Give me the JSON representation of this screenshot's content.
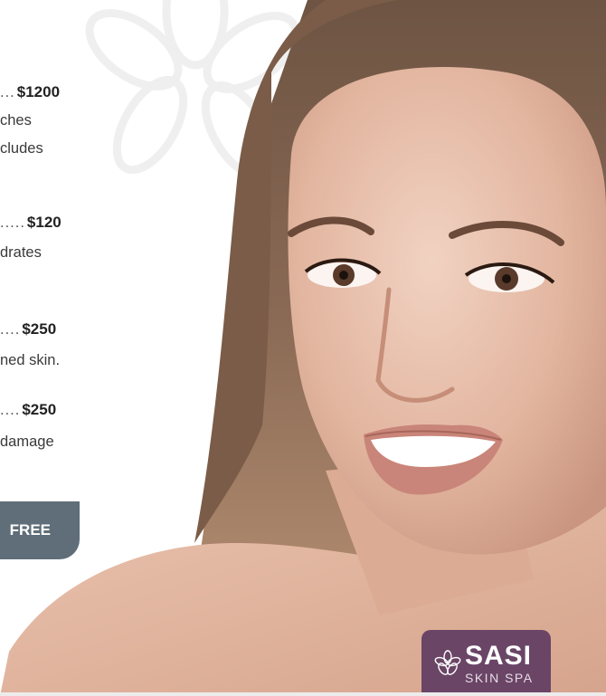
{
  "menu": {
    "items": [
      {
        "dots": "...",
        "price": "$1200",
        "desc": [
          "ches",
          "cludes"
        ]
      },
      {
        "dots": ".....",
        "price": "$120",
        "desc": [
          "drates"
        ]
      },
      {
        "dots": "....",
        "price": "$250",
        "desc": [
          "ned skin."
        ]
      },
      {
        "dots": "....",
        "price": "$250",
        "desc": [
          " damage"
        ]
      }
    ]
  },
  "cta": {
    "label": "FREE"
  },
  "logo": {
    "brand": "SASI",
    "subtitle": "SKIN SPA"
  },
  "colors": {
    "accent_button": "#5f6e78",
    "logo_bg": "#6a4566"
  }
}
